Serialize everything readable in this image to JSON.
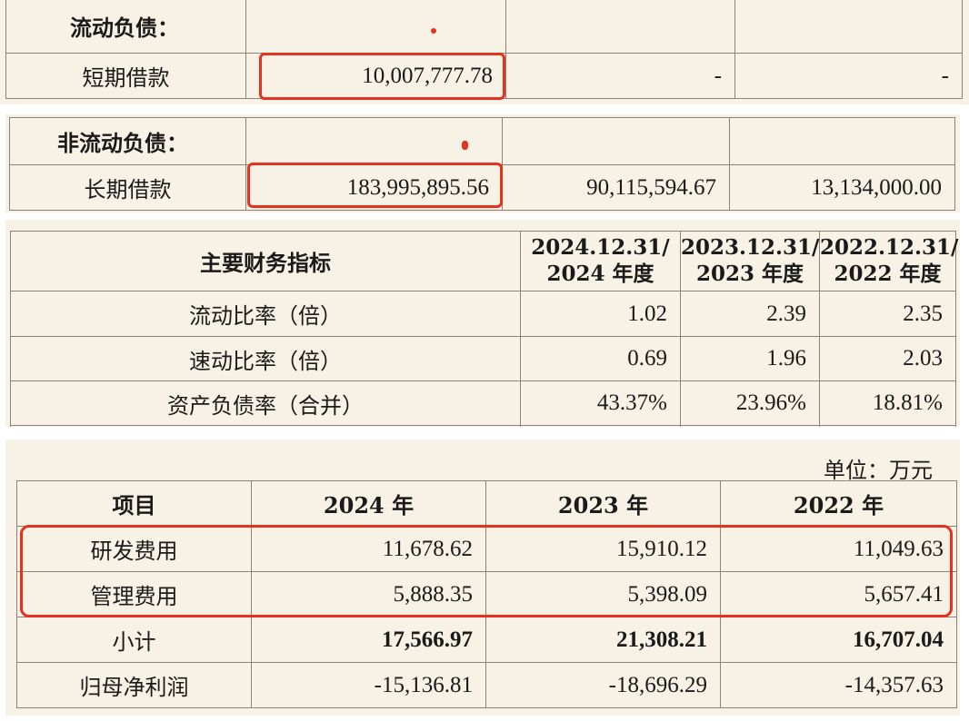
{
  "section1": {
    "header_label": "流动负债：",
    "row": {
      "label": "短期借款",
      "values": [
        "10,007,777.78",
        "-",
        "-"
      ]
    }
  },
  "section2": {
    "header_label": "非流动负债：",
    "row": {
      "label": "长期借款",
      "values": [
        "183,995,895.56",
        "90,115,594.67",
        "13,134,000.00"
      ]
    }
  },
  "section3": {
    "header": {
      "label": "主要财务指标",
      "cols": [
        [
          "2024.12.31/",
          "2024 年度"
        ],
        [
          "2023.12.31/",
          "2023 年度"
        ],
        [
          "2022.12.31/",
          "2022 年度"
        ]
      ]
    },
    "rows": [
      {
        "label": "流动比率（倍）",
        "values": [
          "1.02",
          "2.39",
          "2.35"
        ]
      },
      {
        "label": "速动比率（倍）",
        "values": [
          "0.69",
          "1.96",
          "2.03"
        ]
      },
      {
        "label": "资产负债率（合并）",
        "values": [
          "43.37%",
          "23.96%",
          "18.81%"
        ]
      }
    ]
  },
  "section4": {
    "unit": "单位：万元",
    "header": {
      "label": "项目",
      "cols": [
        "2024 年",
        "2023 年",
        "2022 年"
      ]
    },
    "rows": [
      {
        "label": "研发费用",
        "values": [
          "11,678.62",
          "15,910.12",
          "11,049.63"
        ]
      },
      {
        "label": "管理费用",
        "values": [
          "5,888.35",
          "5,398.09",
          "5,657.41"
        ]
      },
      {
        "label": "小计",
        "values": [
          "17,566.97",
          "21,308.21",
          "16,707.04"
        ]
      },
      {
        "label": "归母净利润",
        "values": [
          "-15,136.81",
          "-18,696.29",
          "-14,357.63"
        ]
      }
    ]
  },
  "colors": {
    "highlight": "#e5321f",
    "background": "#f8f1e5",
    "border": "#8c8279"
  }
}
